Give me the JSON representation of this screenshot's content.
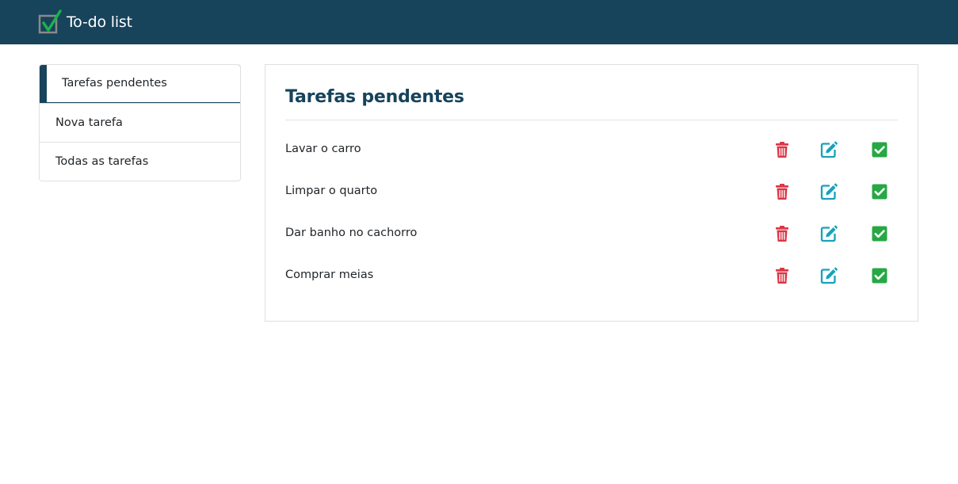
{
  "header": {
    "app_title": "To-do list",
    "logo_icon": "checkbox-check-icon",
    "background_color": "#17435b"
  },
  "sidebar": {
    "items": [
      {
        "label": "Tarefas pendentes",
        "active": true
      },
      {
        "label": "Nova tarefa",
        "active": false
      },
      {
        "label": "Todas as tarefas",
        "active": false
      }
    ]
  },
  "main": {
    "title": "Tarefas pendentes",
    "tasks": [
      {
        "name": "Lavar o carro"
      },
      {
        "name": "Limpar o quarto"
      },
      {
        "name": "Dar banho no cachorro"
      },
      {
        "name": "Comprar meias"
      }
    ],
    "actions": {
      "delete_icon": "trash-icon",
      "edit_icon": "edit-icon",
      "complete_icon": "check-square-icon"
    },
    "colors": {
      "delete": "#dc3545",
      "edit": "#17a2b8",
      "complete": "#28a745",
      "title": "#17435b"
    }
  }
}
